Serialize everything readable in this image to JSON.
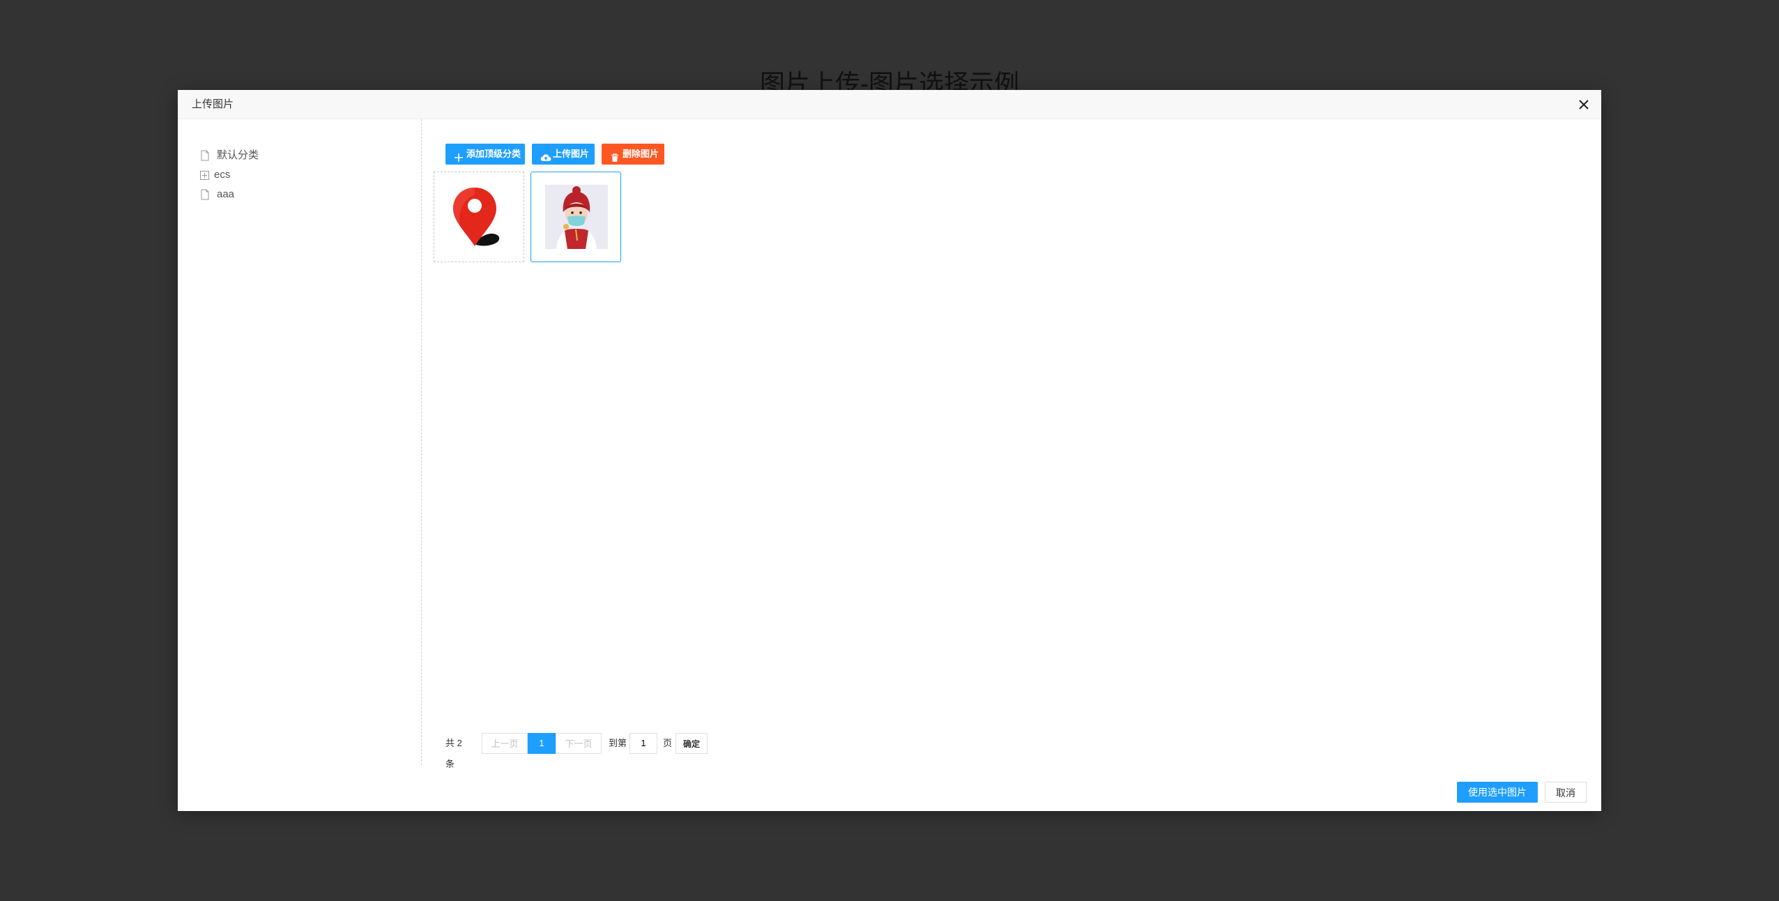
{
  "page": {
    "title": "图片上传-图片选择示例"
  },
  "dialog": {
    "title": "上传图片",
    "close_icon": "close-icon"
  },
  "tree": {
    "items": [
      {
        "label": "默认分类",
        "icon": "file-icon"
      },
      {
        "label": "ecs",
        "icon": "expand-plus-icon"
      },
      {
        "label": "aaa",
        "icon": "file-icon"
      }
    ]
  },
  "toolbar": {
    "add_category_label": "添加顶级分类",
    "upload_label": "上传图片",
    "delete_label": "删除图片",
    "primary_color": "#1e9fff",
    "danger_color": "#ff5722"
  },
  "images": [
    {
      "kind": "location-pin-image",
      "selected": false
    },
    {
      "kind": "masked-person-image",
      "selected": true
    }
  ],
  "pagination": {
    "total_label": "共 2 条",
    "prev_label": "上一页",
    "current_page": "1",
    "next_label": "下一页",
    "goto_label": "到第",
    "goto_value": "1",
    "page_suffix": "页",
    "confirm_label": "确定"
  },
  "footer": {
    "use_selected_label": "使用选中图片",
    "cancel_label": "取消"
  }
}
